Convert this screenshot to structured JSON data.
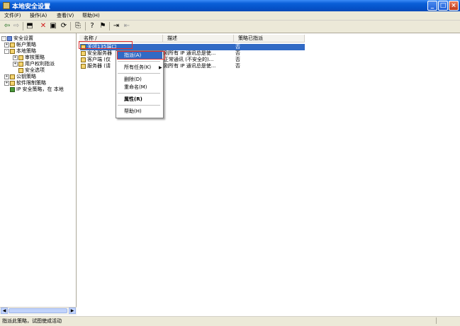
{
  "window": {
    "title": "本地安全设置"
  },
  "menu": [
    "文件(F)",
    "操作(A)",
    "查看(V)",
    "帮助(H)"
  ],
  "toolbar_icons": [
    "back-arrow-icon",
    "forward-arrow-icon",
    "up-folder-icon",
    "delete-x-icon",
    "properties-icon",
    "refresh-icon",
    "export-list-icon",
    "help-icon",
    "assign-icon",
    "unassign-icon"
  ],
  "tree": [
    {
      "label": "安全设置",
      "level": 0,
      "expander": "-",
      "icon": "book"
    },
    {
      "label": "帐户策略",
      "level": 1,
      "expander": "+",
      "icon": "folder"
    },
    {
      "label": "本地策略",
      "level": 1,
      "expander": "-",
      "icon": "folder"
    },
    {
      "label": "审核策略",
      "level": 2,
      "expander": "+",
      "icon": "folder"
    },
    {
      "label": "用户权利指派",
      "level": 2,
      "expander": "+",
      "icon": "folder"
    },
    {
      "label": "安全选项",
      "level": 2,
      "expander": "",
      "icon": "folder"
    },
    {
      "label": "公钥策略",
      "level": 1,
      "expander": "+",
      "icon": "folder"
    },
    {
      "label": "软件限制策略",
      "level": 1,
      "expander": "+",
      "icon": "folder"
    },
    {
      "label": "IP 安全策略，在 本地",
      "level": 1,
      "expander": "",
      "icon": "green"
    }
  ],
  "columns": [
    "名称 /",
    "描述",
    "策略已指派"
  ],
  "rows": [
    {
      "name": "关闭135端口",
      "desc": "",
      "assigned": "否"
    },
    {
      "name": "安全服务器",
      "desc": "刚所有 IP 通讯总是使...",
      "assigned": "否"
    },
    {
      "name": "客户端 (仅",
      "desc": "正常通讯 (不安全的)...",
      "assigned": "否"
    },
    {
      "name": "服务器 (请",
      "desc": "刚所有 IP 通讯总是使...",
      "assigned": "否"
    }
  ],
  "context_menu": {
    "assign": "指派(A)",
    "all_tasks": "所有任务(K)",
    "delete": "删除(D)",
    "rename": "重命名(M)",
    "properties": "属性(R)",
    "help": "帮助(H)"
  },
  "status": "指派此策略，试图使成活动",
  "colors": {
    "title_bar": "#0a5fd8",
    "selection": "#316ac5",
    "highlight_box": "#e23030",
    "chrome": "#ece9d8"
  }
}
